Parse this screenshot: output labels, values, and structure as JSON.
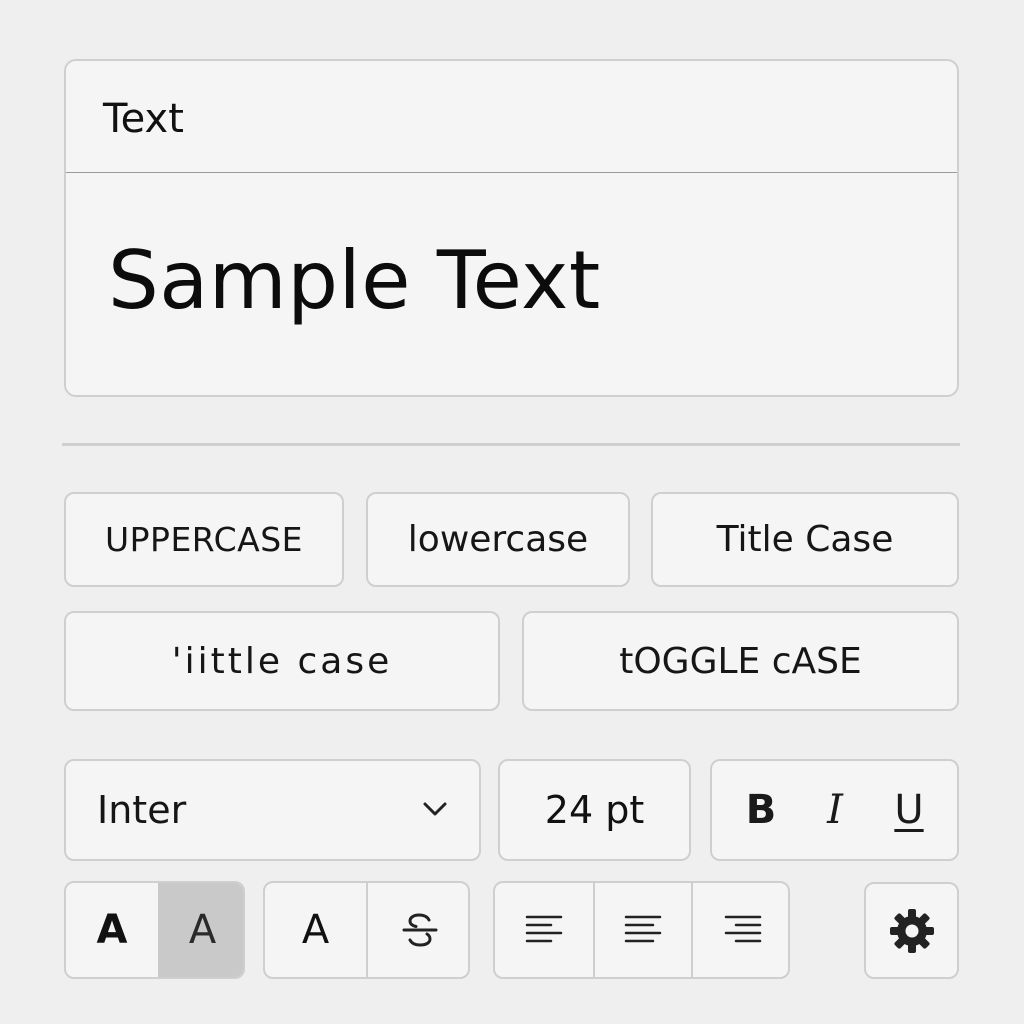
{
  "panel": {
    "title": "Text",
    "sample": "Sample Text"
  },
  "case_buttons": {
    "uppercase": "UPPERCASE",
    "lowercase": "lowercase",
    "title_case": "Title Case",
    "little_case": "'iittle case",
    "toggle_case": "tOGGLE cASE"
  },
  "format": {
    "font_name": "Inter",
    "font_size": "24 pt",
    "bold_label": "B",
    "italic_label": "I",
    "underline_label": "U"
  },
  "bottom": {
    "weight_bold_label": "A",
    "weight_regular_label": "A",
    "weight_selected": "regular",
    "plain_label": "A"
  },
  "icons": {
    "chevron": "chevron-down-icon",
    "strikethrough": "strikethrough-icon",
    "align_left": "align-left-icon",
    "align_center": "align-center-icon",
    "align_right": "align-right-icon",
    "settings": "gear-icon"
  },
  "colors": {
    "background": "#efefef",
    "surface": "#f5f5f5",
    "border": "#cfcfcf",
    "selected": "#c9c9c9"
  }
}
